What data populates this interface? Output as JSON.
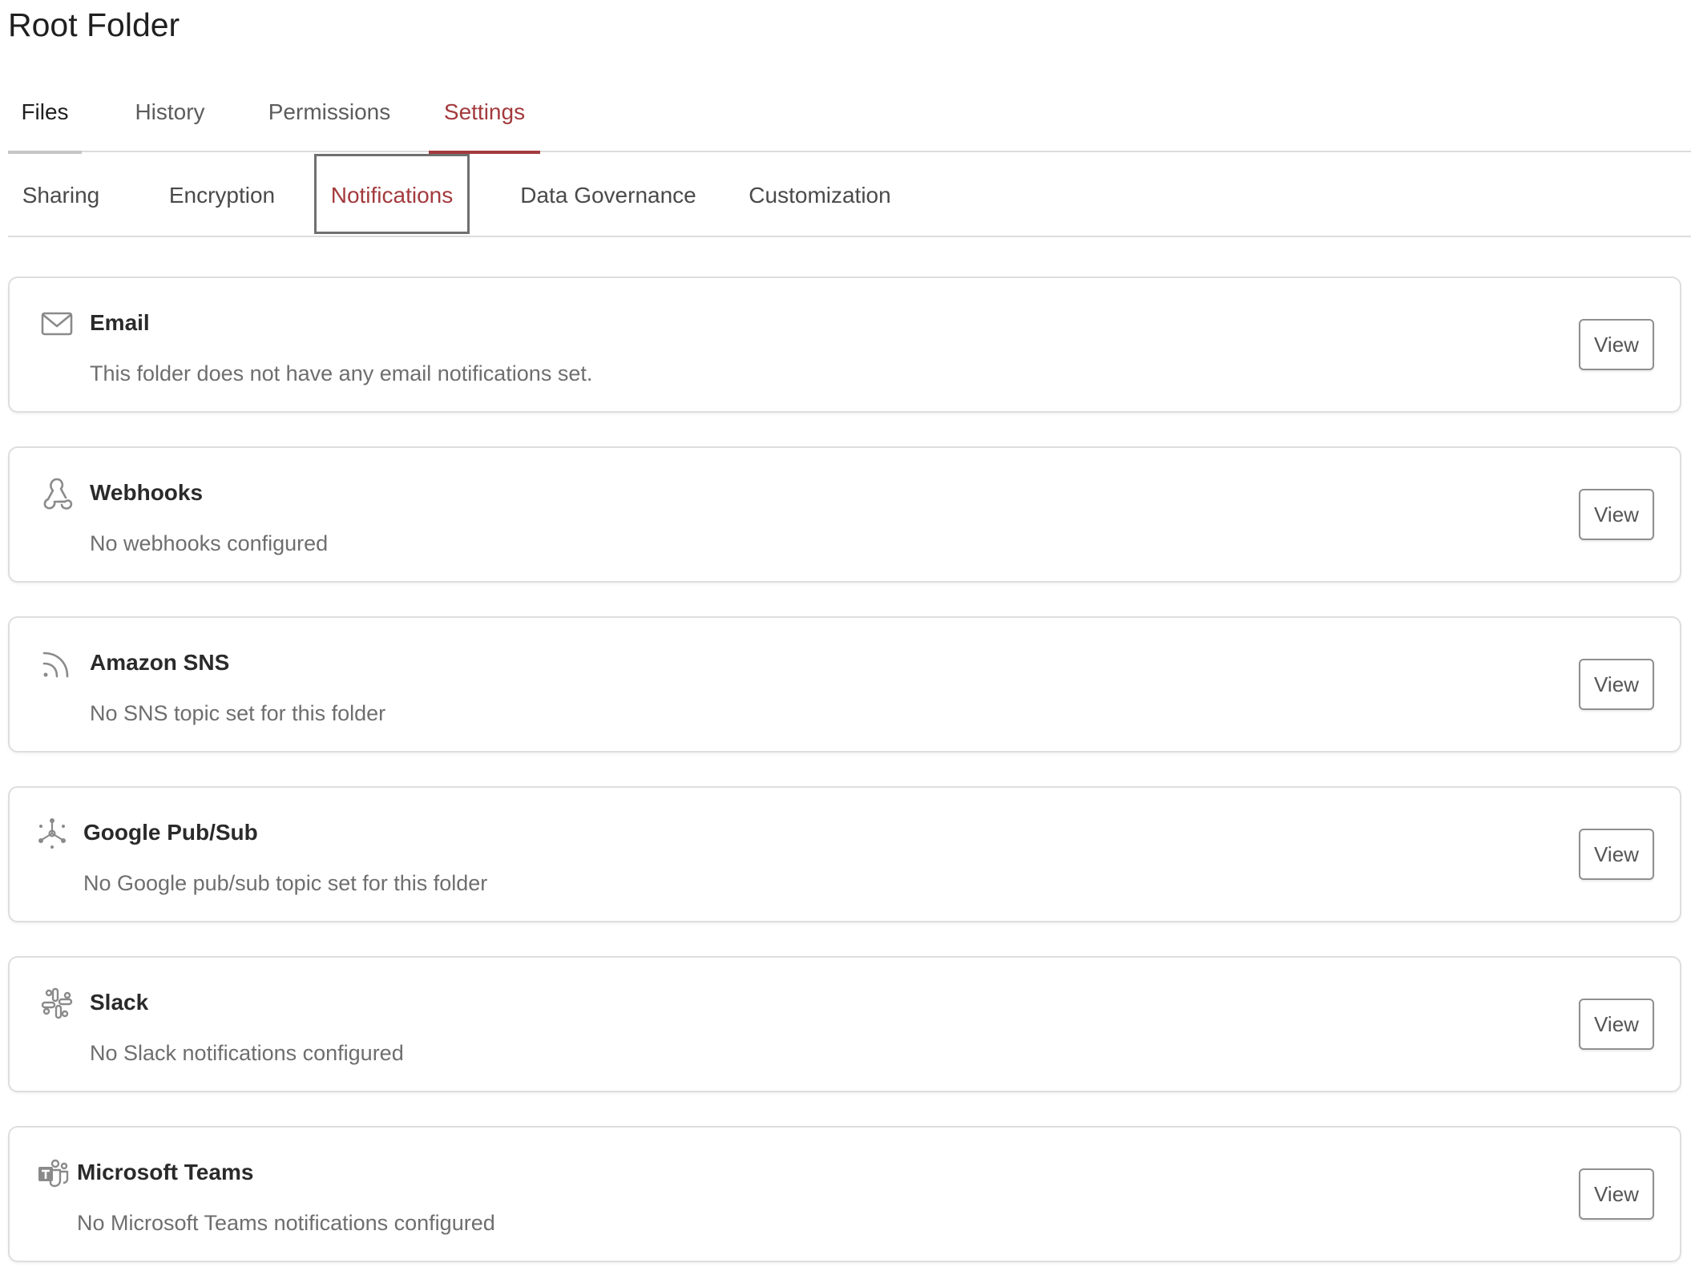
{
  "page": {
    "title": "Root Folder"
  },
  "tabs": [
    {
      "label": "Files"
    },
    {
      "label": "History"
    },
    {
      "label": "Permissions"
    },
    {
      "label": "Settings"
    }
  ],
  "subtabs": [
    {
      "label": "Sharing"
    },
    {
      "label": "Encryption"
    },
    {
      "label": "Notifications"
    },
    {
      "label": "Data Governance"
    },
    {
      "label": "Customization"
    }
  ],
  "active_tab": "Settings",
  "active_subtab": "Notifications",
  "cards": [
    {
      "title": "Email",
      "description": "This folder does not have any email notifications set.",
      "button": "View",
      "icon": "email-icon"
    },
    {
      "title": "Webhooks",
      "description": "No webhooks configured",
      "button": "View",
      "icon": "webhook-icon"
    },
    {
      "title": "Amazon SNS",
      "description": "No SNS topic set for this folder",
      "button": "View",
      "icon": "feed-icon"
    },
    {
      "title": "Google Pub/Sub",
      "description": "No Google pub/sub topic set for this folder",
      "button": "View",
      "icon": "pubsub-icon"
    },
    {
      "title": "Slack",
      "description": "No Slack notifications configured",
      "button": "View",
      "icon": "slack-icon"
    },
    {
      "title": "Microsoft Teams",
      "description": "No Microsoft Teams notifications configured",
      "button": "View",
      "icon": "teams-icon"
    }
  ],
  "colors": {
    "accent": "#a33a3d",
    "text": "#1f1f1f",
    "muted": "#6e6e6e",
    "border": "#dedede"
  }
}
